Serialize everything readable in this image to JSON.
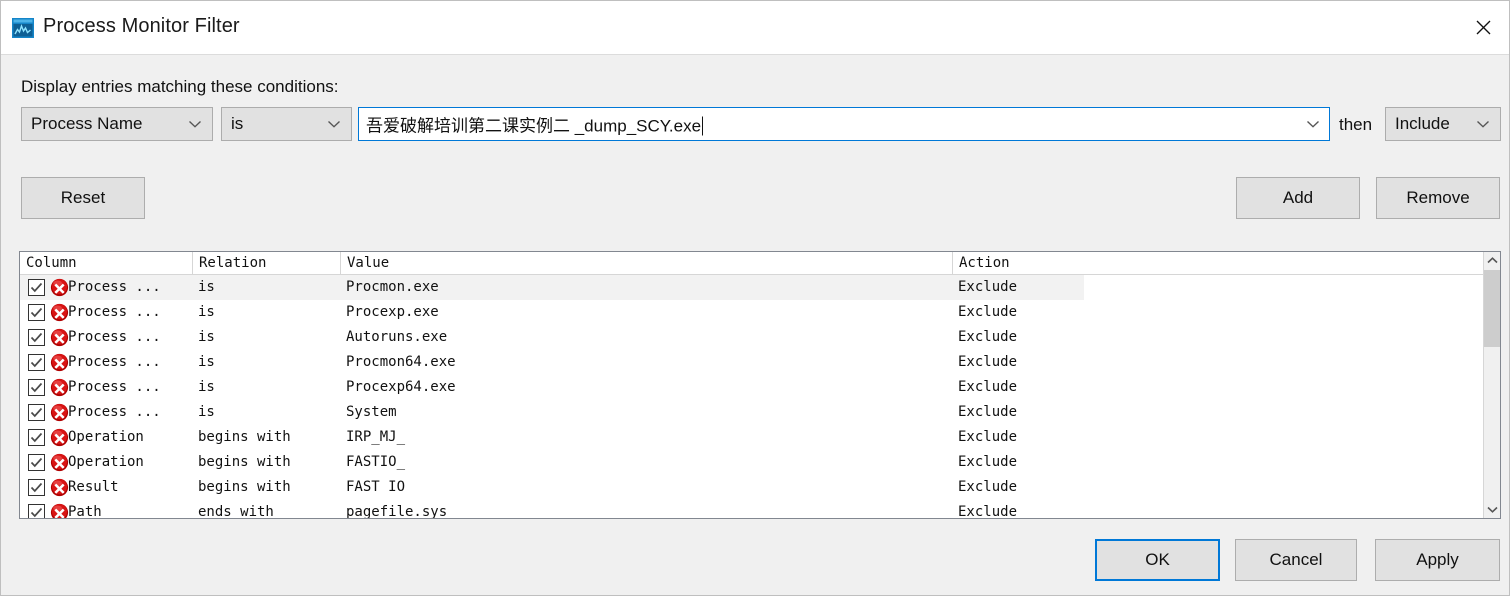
{
  "window": {
    "title": "Process Monitor Filter",
    "icon": "procmon-icon",
    "close_label": "✕"
  },
  "filter": {
    "section_label": "Display entries matching these conditions:",
    "column_value": "Process Name",
    "relation_value": "is",
    "value_text": "吾爱破解培训第二课实例二 _dump_SCY.exe",
    "value_placeholder": "",
    "then_label": "then",
    "action_value": "Include"
  },
  "toolbar": {
    "reset_label": "Reset",
    "add_label": "Add",
    "remove_label": "Remove"
  },
  "list": {
    "headers": [
      "Column",
      "Relation",
      "Value",
      "Action"
    ],
    "rows": [
      {
        "checked": true,
        "icon": "exclude-icon",
        "column": "Process ...",
        "relation": "is",
        "value": "Procmon.exe",
        "action": "Exclude",
        "selected": true
      },
      {
        "checked": true,
        "icon": "exclude-icon",
        "column": "Process ...",
        "relation": "is",
        "value": "Procexp.exe",
        "action": "Exclude",
        "selected": false
      },
      {
        "checked": true,
        "icon": "exclude-icon",
        "column": "Process ...",
        "relation": "is",
        "value": "Autoruns.exe",
        "action": "Exclude",
        "selected": false
      },
      {
        "checked": true,
        "icon": "exclude-icon",
        "column": "Process ...",
        "relation": "is",
        "value": "Procmon64.exe",
        "action": "Exclude",
        "selected": false
      },
      {
        "checked": true,
        "icon": "exclude-icon",
        "column": "Process ...",
        "relation": "is",
        "value": "Procexp64.exe",
        "action": "Exclude",
        "selected": false
      },
      {
        "checked": true,
        "icon": "exclude-icon",
        "column": "Process ...",
        "relation": "is",
        "value": "System",
        "action": "Exclude",
        "selected": false
      },
      {
        "checked": true,
        "icon": "exclude-icon",
        "column": "Operation",
        "relation": "begins with",
        "value": "IRP_MJ_",
        "action": "Exclude",
        "selected": false
      },
      {
        "checked": true,
        "icon": "exclude-icon",
        "column": "Operation",
        "relation": "begins with",
        "value": "FASTIO_",
        "action": "Exclude",
        "selected": false
      },
      {
        "checked": true,
        "icon": "exclude-icon",
        "column": "Result",
        "relation": "begins with",
        "value": "FAST IO",
        "action": "Exclude",
        "selected": false
      },
      {
        "checked": true,
        "icon": "exclude-icon",
        "column": "Path",
        "relation": "ends with",
        "value": "pagefile.sys",
        "action": "Exclude",
        "selected": false
      }
    ]
  },
  "footer": {
    "ok_label": "OK",
    "cancel_label": "Cancel",
    "apply_label": "Apply"
  },
  "colors": {
    "accent": "#0078d7",
    "exclude": "#cc0000",
    "window_bg": "#f0f0f0",
    "button_face": "#e1e1e1"
  }
}
